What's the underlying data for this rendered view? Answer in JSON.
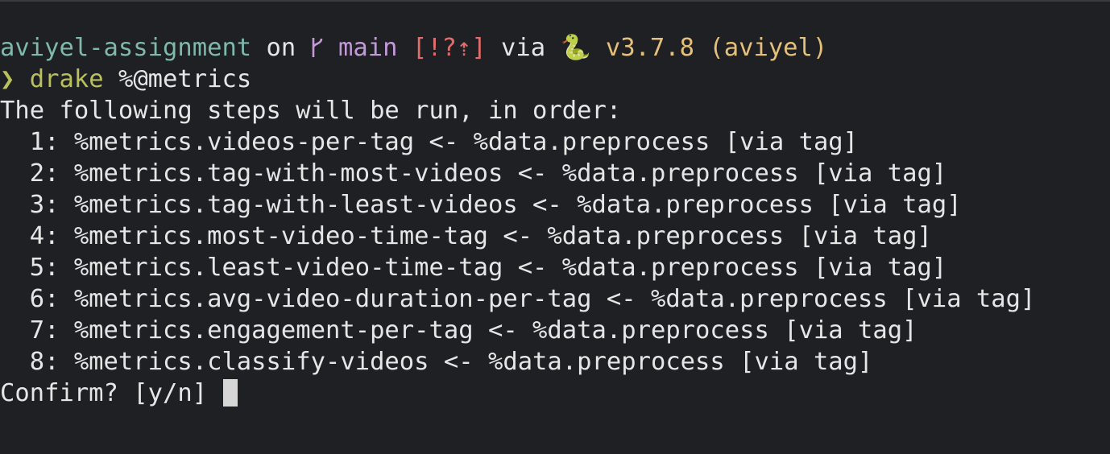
{
  "prompt": {
    "directory": "aviyel-assignment",
    "on_word": " on ",
    "branch_icon": "",
    "branch": "main",
    "git_status": "[!?⇡]",
    "via_word": " via ",
    "python_icon": "🐍",
    "python_version": " v3.7.8 (aviyel)"
  },
  "command": {
    "symbol": "❯",
    "name": "drake",
    "args": "%@metrics"
  },
  "output": {
    "header": "The following steps will be run, in order:",
    "steps": [
      "  1: %metrics.videos-per-tag <- %data.preprocess [via tag]",
      "  2: %metrics.tag-with-most-videos <- %data.preprocess [via tag]",
      "  3: %metrics.tag-with-least-videos <- %data.preprocess [via tag]",
      "  4: %metrics.most-video-time-tag <- %data.preprocess [via tag]",
      "  5: %metrics.least-video-time-tag <- %data.preprocess [via tag]",
      "  6: %metrics.avg-video-duration-per-tag <- %data.preprocess [via tag]",
      "  7: %metrics.engagement-per-tag <- %data.preprocess [via tag]",
      "  8: %metrics.classify-videos <- %data.preprocess [via tag]"
    ],
    "confirm": "Confirm? [y/n] "
  }
}
